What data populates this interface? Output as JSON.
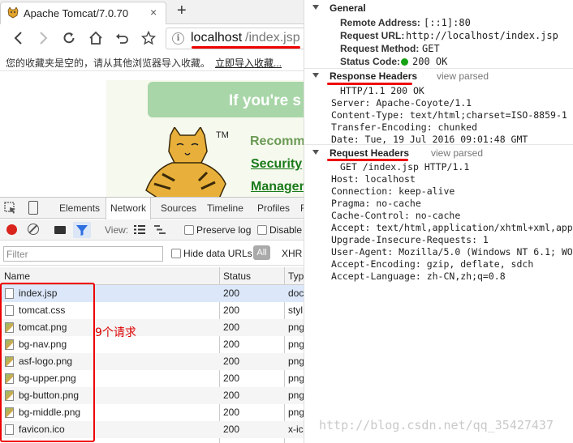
{
  "browser": {
    "tab_title": "Apache Tomcat/7.0.70",
    "tab_close": "×",
    "new_tab": "+",
    "url_host": "localhost",
    "url_path": "/index.jsp",
    "bookmark_message": "您的收藏夹是空的，请从其他浏览器导入收藏。",
    "bookmark_import_link": "立即导入收藏..."
  },
  "page": {
    "banner": "If you're s",
    "trademark": "TM",
    "recommended": "Recomm",
    "links": [
      "Security",
      "Manager"
    ]
  },
  "devtools": {
    "tabs": [
      "Elements",
      "Network",
      "Sources",
      "Timeline",
      "Profiles",
      "R"
    ],
    "active_tab": "Network",
    "toolbar": {
      "view_label": "View:",
      "preserve_log": "Preserve log",
      "disable_cache": "Disable"
    },
    "filter_placeholder": "Filter",
    "hide_data_urls": "Hide data URLs",
    "all_button": "All",
    "xhr": "XHR",
    "columns": [
      "Name",
      "Status",
      "Typ"
    ],
    "requests": [
      {
        "name": "index.jsp",
        "status": "200",
        "type": "doc"
      },
      {
        "name": "tomcat.css",
        "status": "200",
        "type": "styl"
      },
      {
        "name": "tomcat.png",
        "status": "200",
        "type": "png"
      },
      {
        "name": "bg-nav.png",
        "status": "200",
        "type": "png"
      },
      {
        "name": "asf-logo.png",
        "status": "200",
        "type": "png"
      },
      {
        "name": "bg-upper.png",
        "status": "200",
        "type": "png"
      },
      {
        "name": "bg-button.png",
        "status": "200",
        "type": "png"
      },
      {
        "name": "bg-middle.png",
        "status": "200",
        "type": "png"
      },
      {
        "name": "favicon.ico",
        "status": "200",
        "type": "x-ic"
      }
    ],
    "annotation": "9个请求"
  },
  "headers": {
    "general": {
      "title": "General",
      "remote_address_key": "Remote Address:",
      "remote_address": "[::1]:80",
      "request_url_key": "Request URL:",
      "request_url": "http://localhost/index.jsp",
      "request_method_key": "Request Method:",
      "request_method": "GET",
      "status_code_key": "Status Code:",
      "status_code": "200 OK"
    },
    "response": {
      "title": "Response Headers",
      "view_parsed": "view parsed",
      "lines": [
        "HTTP/1.1 200 OK",
        "Server: Apache-Coyote/1.1",
        "Content-Type: text/html;charset=ISO-8859-1",
        "Transfer-Encoding: chunked",
        "Date: Tue, 19 Jul 2016 09:01:48 GMT"
      ]
    },
    "request": {
      "title": "Request Headers",
      "view_parsed": "view parsed",
      "lines": [
        "GET /index.jsp HTTP/1.1",
        "Host: localhost",
        "Connection: keep-alive",
        "Pragma: no-cache",
        "Cache-Control: no-cache",
        "Accept: text/html,application/xhtml+xml,app",
        "Upgrade-Insecure-Requests: 1",
        "User-Agent: Mozilla/5.0 (Windows NT 6.1; WO",
        "Accept-Encoding: gzip, deflate, sdch",
        "Accept-Language: zh-CN,zh;q=0.8"
      ]
    }
  },
  "watermark": "http://blog.csdn.net/qq_35427437",
  "colors": {
    "annotation_red": "#e00000",
    "status_green": "#16a316",
    "tomcat_green": "#1a7a1a"
  }
}
